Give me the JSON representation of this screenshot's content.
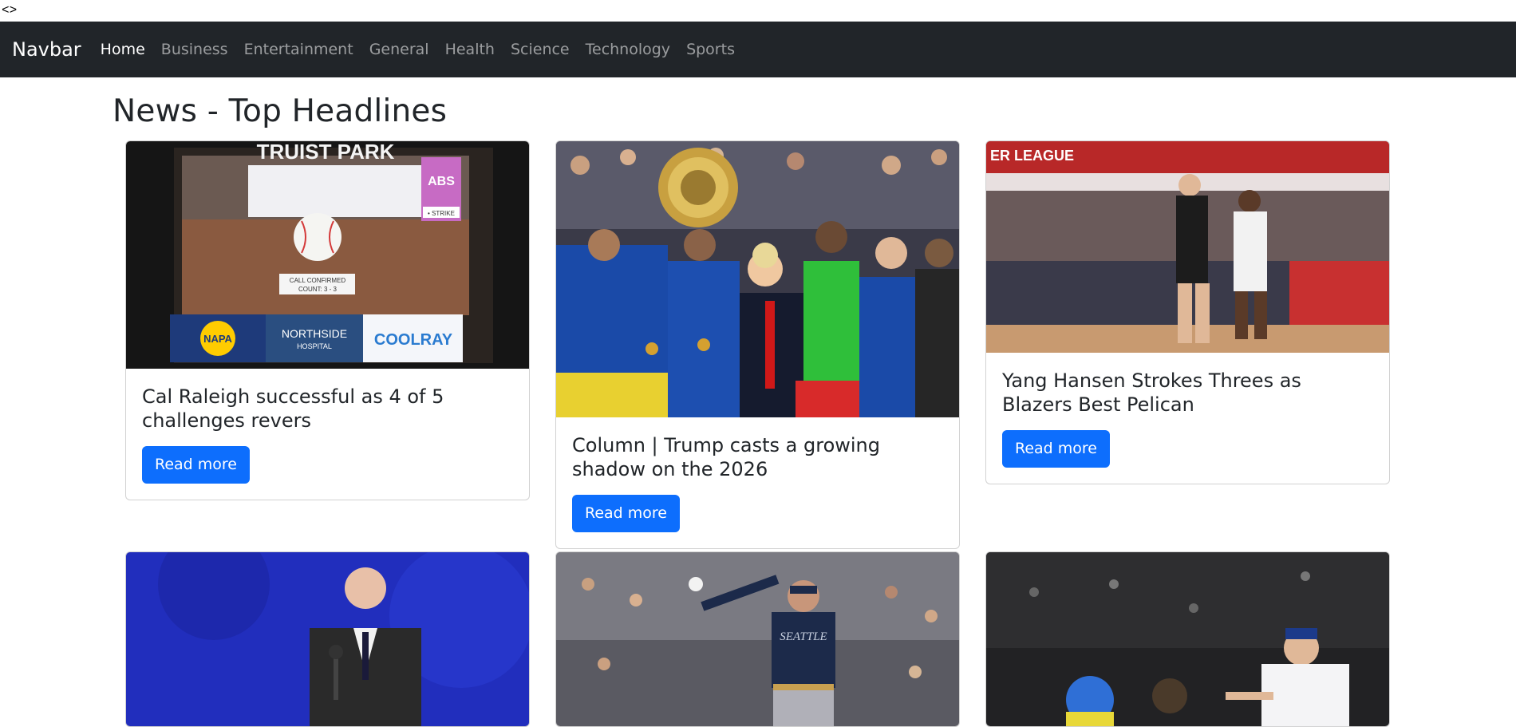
{
  "top_text": "<>",
  "navbar": {
    "brand": "Navbar",
    "links": [
      "Home",
      "Business",
      "Entertainment",
      "General",
      "Health",
      "Science",
      "Technology",
      "Sports"
    ]
  },
  "page_title": "News - Top Headlines",
  "cards": [
    {
      "title": "Cal Raleigh successful as 4 of 5 challenges revers",
      "button": "Read more",
      "image_text": {
        "park": "TRUIST PARK",
        "abs": "ABS",
        "strike": "• STRIKE",
        "call": "CALL CONFIRMED",
        "count": "COUNT: 3 - 3",
        "napa": "NAPA",
        "northside": "NORTHSIDE",
        "hospital": "HOSPITAL",
        "coolray": "COOLRAY"
      }
    },
    {
      "title": "Column | Trump casts a growing shadow on the 2026",
      "button": "Read more"
    },
    {
      "title": "Yang Hansen Strokes Threes as Blazers Best Pelican",
      "button": "Read more",
      "image_text": {
        "league": "ER LEAGUE"
      }
    },
    {
      "title": "",
      "button": ""
    },
    {
      "title": "",
      "button": "",
      "image_text": {
        "jersey": "SEATTLE"
      }
    },
    {
      "title": "",
      "button": ""
    }
  ]
}
